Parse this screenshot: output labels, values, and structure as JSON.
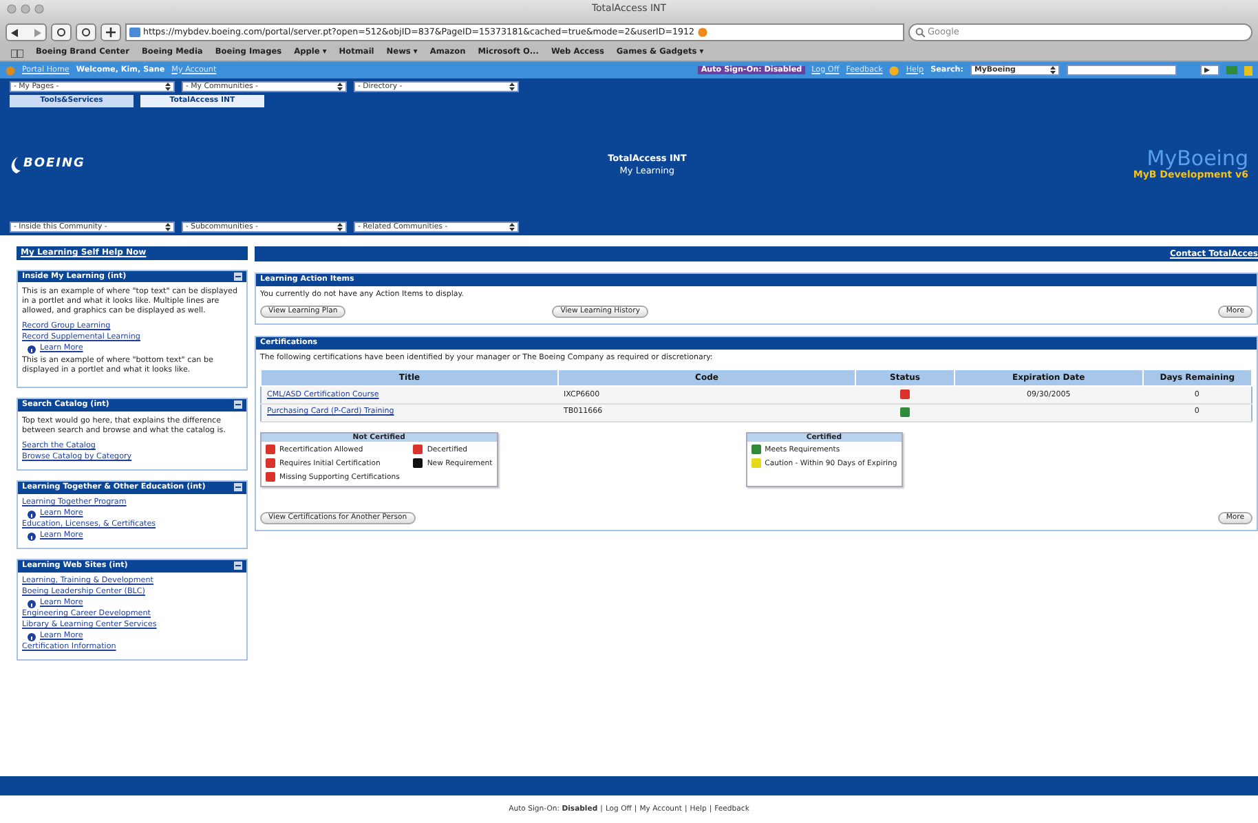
{
  "window": {
    "title": "TotalAccess INT"
  },
  "toolbar": {
    "url": "https://mybdev.boeing.com/portal/server.pt?open=512&objID=837&PageID=15373181&cached=true&mode=2&userID=1912",
    "search_placeholder": "Google"
  },
  "bookmarks": [
    {
      "label": "Boeing Brand Center"
    },
    {
      "label": "Boeing Media"
    },
    {
      "label": "Boeing Images"
    },
    {
      "label": "Apple ▾"
    },
    {
      "label": "Hotmail"
    },
    {
      "label": "News ▾"
    },
    {
      "label": "Amazon"
    },
    {
      "label": "Microsoft O..."
    },
    {
      "label": "Web Access"
    },
    {
      "label": "Games & Gadgets ▾"
    }
  ],
  "portal_bar": {
    "home": "Portal Home",
    "welcome": "Welcome, Kim, Sane",
    "account": "My Account",
    "auto_sign_on": "Auto Sign-On: Disabled",
    "log_off": "Log Off",
    "feedback": "Feedback",
    "help": "Help",
    "search_label": "Search:",
    "search_scope": "MyBoeing"
  },
  "top_dropdowns": [
    "- My Pages -",
    "- My Communities -",
    "- Directory -"
  ],
  "tabs": [
    {
      "label": "Tools&Services",
      "selected": false
    },
    {
      "label": "TotalAccess INT",
      "selected": true
    }
  ],
  "header": {
    "logo": "BOEING",
    "title": "TotalAccess INT",
    "subtitle": "My Learning",
    "brand": "MyBoeing",
    "environment": "MyB Development v6"
  },
  "community_dropdowns": [
    "- Inside this Community -",
    "- Subcommunities -",
    "- Related Communities -"
  ],
  "sidebar": {
    "title": "My Learning Self Help Now",
    "portlets": [
      {
        "title": "Inside My Learning (int)",
        "items": [
          {
            "kind": "text",
            "text": "This is an example of where \"top text\" can be displayed in a portlet and what it looks like. Multiple lines are allowed, and graphics can be displayed as well."
          },
          {
            "kind": "link",
            "text": "Record Group Learning"
          },
          {
            "kind": "link",
            "text": "Record Supplemental Learning"
          },
          {
            "kind": "more",
            "text": "Learn More"
          },
          {
            "kind": "text",
            "text": "This is an example of where \"bottom text\" can be displayed in a portlet and what it looks like."
          }
        ]
      },
      {
        "title": "Search Catalog (int)",
        "items": [
          {
            "kind": "text",
            "text": "Top text would go here, that explains the difference between search and browse and what the catalog is."
          },
          {
            "kind": "link",
            "text": "Search the Catalog"
          },
          {
            "kind": "link",
            "text": "Browse Catalog by Category"
          }
        ]
      },
      {
        "title": "Learning Together & Other Education (int)",
        "items": [
          {
            "kind": "link",
            "text": "Learning Together Program"
          },
          {
            "kind": "more",
            "text": "Learn More"
          },
          {
            "kind": "link",
            "text": "Education, Licenses, & Certificates"
          },
          {
            "kind": "more",
            "text": "Learn More"
          }
        ]
      },
      {
        "title": "Learning Web Sites (int)",
        "items": [
          {
            "kind": "link",
            "text": "Learning, Training & Development"
          },
          {
            "kind": "link",
            "text": "Boeing Leadership Center (BLC)"
          },
          {
            "kind": "more",
            "text": "Learn More"
          },
          {
            "kind": "link",
            "text": "Engineering Career Development"
          },
          {
            "kind": "link",
            "text": "Library & Learning Center Services"
          },
          {
            "kind": "more",
            "text": "Learn More"
          },
          {
            "kind": "link",
            "text": "Certification Information"
          }
        ]
      }
    ]
  },
  "main": {
    "contact": "Contact TotalAcces",
    "action_items": {
      "title": "Learning Action Items",
      "message": "You currently do not have any Action Items to display.",
      "buttons": [
        "View Learning Plan",
        "View Learning History"
      ],
      "more": "More"
    },
    "certifications": {
      "title": "Certifications",
      "intro": "The following certifications have been identified by your manager or The Boeing Company as required or discretionary:",
      "columns": [
        "Title",
        "Code",
        "Status",
        "Expiration Date",
        "Days Remaining"
      ],
      "rows": [
        {
          "title": "CML/ASD Certification Course",
          "code": "IXCP6600",
          "color": "#d9332b",
          "expiration": "09/30/2005",
          "days": "0"
        },
        {
          "title": "Purchasing Card (P-Card) Training",
          "code": "TB011666",
          "color": "#2f8a3a",
          "expiration": "",
          "days": "0"
        }
      ],
      "legends": [
        {
          "title": "Not Certified",
          "items": [
            {
              "label": "Recertification Allowed",
              "color": "#d9332b"
            },
            {
              "label": "Decertified",
              "color": "#d9332b"
            },
            {
              "label": "Requires Initial Certification",
              "color": "#d9332b"
            },
            {
              "label": "New Requirement",
              "color": "#111111"
            },
            {
              "label": "Missing Supporting Certifications",
              "color": "#d9332b"
            }
          ]
        },
        {
          "title": "Certified",
          "items": [
            {
              "label": "Meets Requirements",
              "color": "#2f8a3a"
            },
            {
              "label": "Caution - Within 90 Days of Expiring",
              "color": "#e6d81c"
            }
          ]
        }
      ],
      "button": "View Certifications for Another Person",
      "more": "More"
    }
  },
  "footer": [
    {
      "kind": "text",
      "text": "Auto Sign-On: **Disabled**"
    },
    {
      "kind": "sep",
      "text": "|"
    },
    {
      "kind": "link",
      "text": "Log Off"
    },
    {
      "kind": "sep",
      "text": "|"
    },
    {
      "kind": "link",
      "text": "My Account"
    },
    {
      "kind": "sep",
      "text": "|"
    },
    {
      "kind": "link",
      "text": "Help"
    },
    {
      "kind": "sep",
      "text": "|"
    },
    {
      "kind": "link",
      "text": "Feedback"
    }
  ]
}
